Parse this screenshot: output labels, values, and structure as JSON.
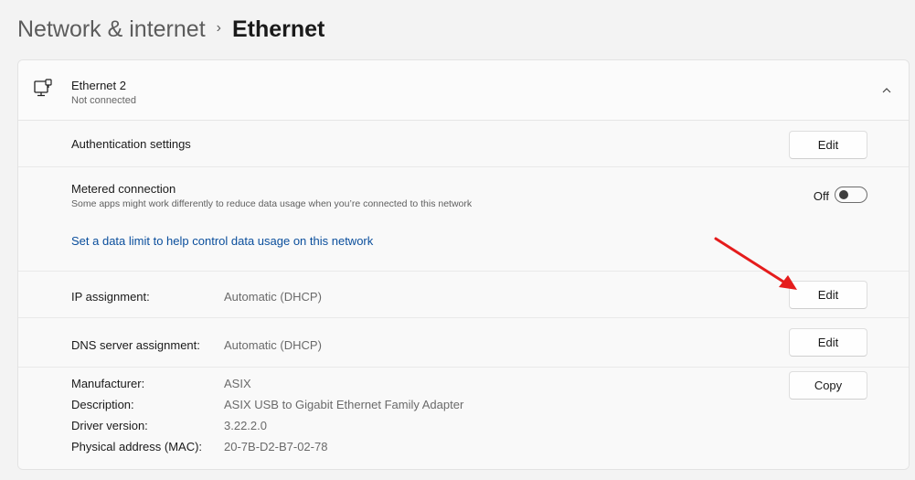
{
  "breadcrumb": {
    "parent": "Network & internet",
    "separator": "›",
    "current": "Ethernet"
  },
  "adapter": {
    "name": "Ethernet 2",
    "status": "Not connected",
    "icon": "ethernet-monitor-icon",
    "expand_icon": "chevron-up-icon"
  },
  "authentication": {
    "label": "Authentication settings",
    "button": "Edit"
  },
  "metered": {
    "label": "Metered connection",
    "description": "Some apps might work differently to reduce data usage when you’re connected to this network",
    "toggle_state": "Off",
    "link": "Set a data limit to help control data usage on this network"
  },
  "ip_assignment": {
    "label": "IP assignment:",
    "value": "Automatic (DHCP)",
    "button": "Edit"
  },
  "dns_assignment": {
    "label": "DNS server assignment:",
    "value": "Automatic (DHCP)",
    "button": "Edit"
  },
  "properties": {
    "manufacturer_label": "Manufacturer:",
    "manufacturer": "ASIX",
    "description_label": "Description:",
    "description": "ASIX USB to Gigabit Ethernet Family Adapter",
    "driver_label": "Driver version:",
    "driver": "3.22.2.0",
    "mac_label": "Physical address (MAC):",
    "mac": "20-7B-D2-B7-02-78",
    "button": "Copy"
  },
  "colors": {
    "background": "#f3f3f3",
    "link": "#0a4e9c",
    "annotation_arrow": "#e51c1c"
  }
}
